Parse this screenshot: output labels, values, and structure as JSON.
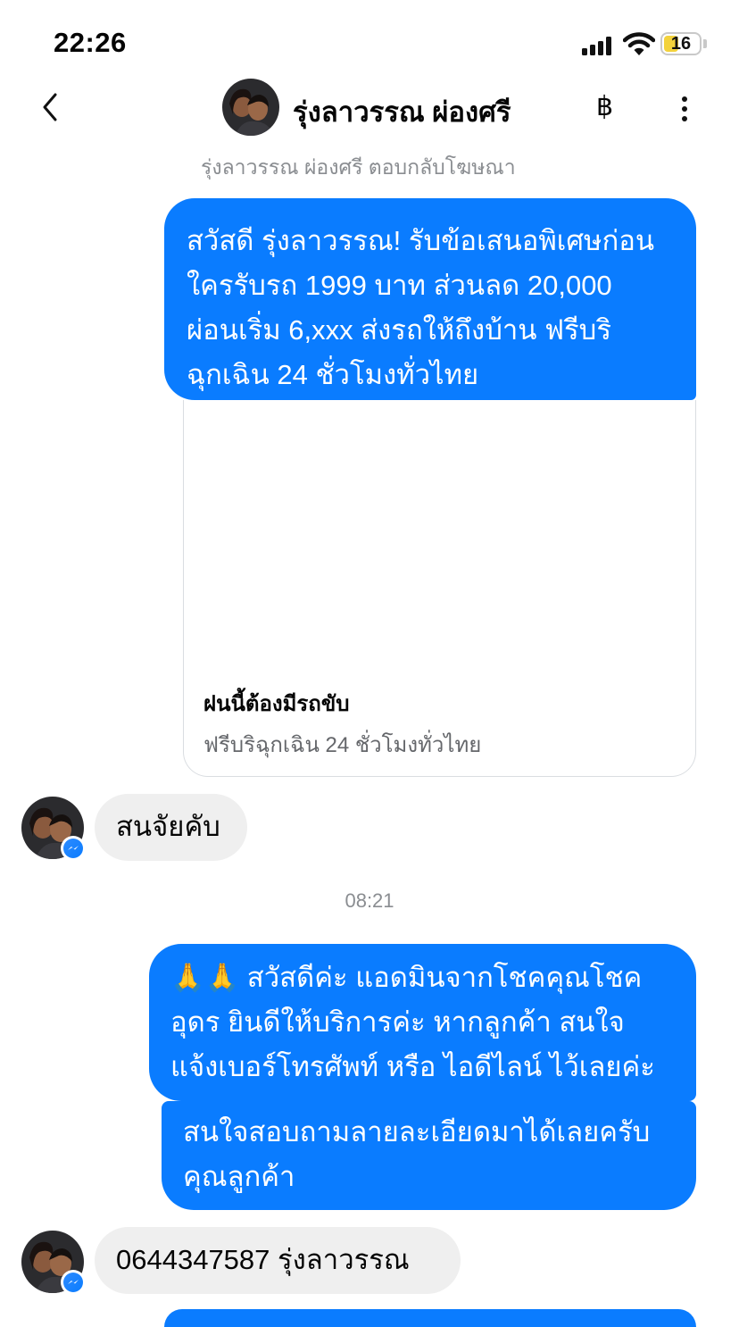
{
  "status_bar": {
    "time": "22:26",
    "battery": "16"
  },
  "header": {
    "contact_name": "รุ่งลาวรรณ ผ่องศรี",
    "baht_symbol": "฿",
    "reply_note": "รุ่งลาวรรณ ผ่องศรี ตอบกลับโฆษณา"
  },
  "messages": [
    {
      "from": "page",
      "lines": [
        "สวัสดี รุ่งลาวรรณ! รับข้อเสนอพิเศษก่อน",
        "ใครรับรถ 1999 บาท ส่วนลด 20,000",
        "ผ่อนเริ่ม 6,xxx ส่งรถให้ถึงบ้าน ฟรีบริ",
        "ฉุกเฉิน 24 ชั่วโมงทั่วไทย"
      ],
      "card": {
        "title": "ฝนนี้ต้องมีรถขับ",
        "subtitle": "ฟรีบริฉุกเฉิน 24 ชั่วโมงทั่วไทย"
      }
    },
    {
      "from": "contact",
      "text": "สนจัยคับ"
    },
    {
      "timestamp": "08:21"
    },
    {
      "from": "page",
      "lines": [
        "🙏🙏 สวัสดีค่ะ แอดมินจากโชคคุณโชค",
        "อุดร ยินดีให้บริการค่ะ หากลูกค้า สนใจ",
        "แจ้งเบอร์โทรศัพท์ หรือ ไอดีไลน์ ไว้เลยค่ะ"
      ]
    },
    {
      "from": "page",
      "lines": [
        "สนใจสอบถามลายละเอียดมาได้เลยครับ",
        "คุณลูกค้า"
      ]
    },
    {
      "from": "contact",
      "text": "0644347587 รุ่งลาวรรณ"
    }
  ],
  "colors": {
    "outgoing": "#0a7cff",
    "incoming": "#efefef",
    "muted": "#8a8d91"
  }
}
